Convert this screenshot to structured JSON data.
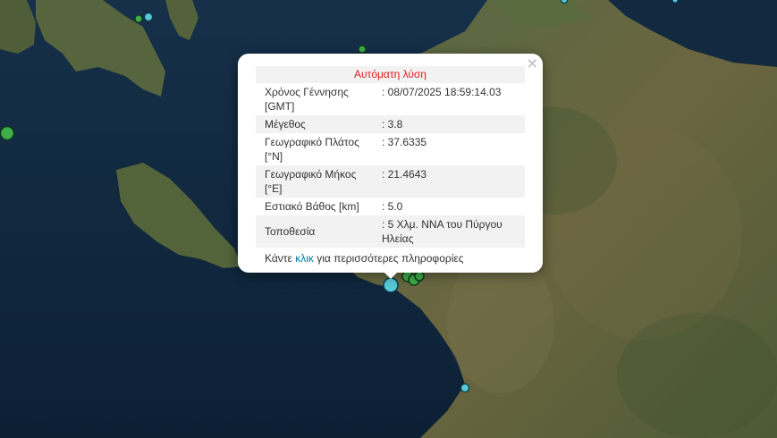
{
  "popup": {
    "title": "Αυτόματη λύση",
    "close_symbol": "×",
    "rows": [
      {
        "label": "Χρόνος Γέννησης [GMT]",
        "value": ": 08/07/2025 18:59:14.03"
      },
      {
        "label": "Μέγεθος",
        "value": ": 3.8"
      },
      {
        "label": "Γεωγραφικό Πλάτος [°N]",
        "value": ": 37.6335"
      },
      {
        "label": "Γεωγραφικό Μήκος [°E]",
        "value": ": 21.4643"
      },
      {
        "label": "Εστιακό Βάθος [km]",
        "value": ": 5.0"
      },
      {
        "label": "Τοποθεσία",
        "value": ": 5 Χλμ. ΝΝΑ του Πύργου Ηλείας"
      }
    ],
    "footer_prefix": "Κάντε ",
    "footer_link": "κλικ",
    "footer_suffix": " για περισσότερες πληροφορίες"
  },
  "colors": {
    "sea": "#10253b",
    "land": "#4a5a36",
    "recent_marker": "#56c9d6",
    "older_marker": "#3fae49",
    "title_red": "#e31b1b",
    "link_blue": "#0078a8"
  }
}
